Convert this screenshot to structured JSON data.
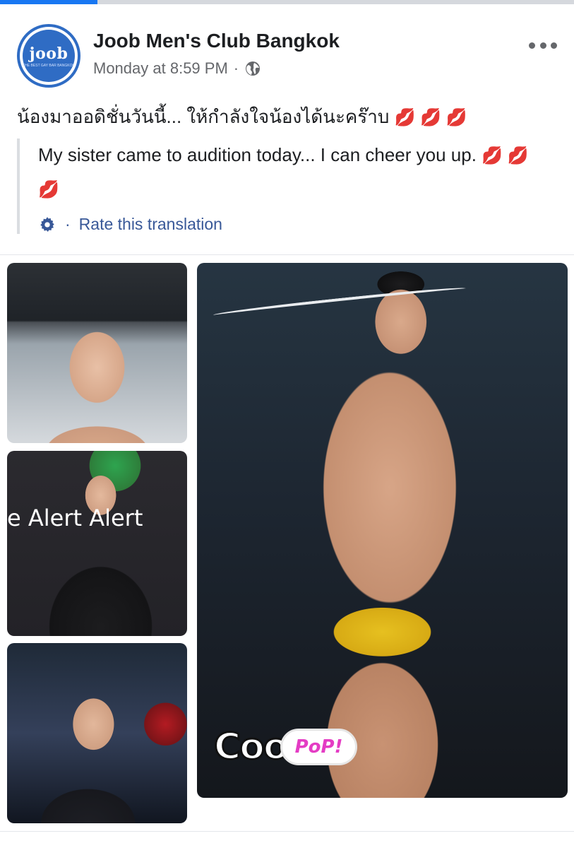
{
  "progress": {
    "value": 0.17,
    "color": "#1877f2"
  },
  "post": {
    "page_name": "Joob Men's Club Bangkok",
    "avatar": {
      "logo_text": "joob",
      "subtitle": "THE BEST GAY BAR BANGKOK"
    },
    "timestamp": "Monday at 8:59 PM",
    "separator": "·",
    "audience_icon": "globe-icon",
    "more_icon": "ellipsis-icon",
    "text": "น้องมาออดิชั่นวันนี้... ให้กำลังใจน้องได้นะคร๊าบ",
    "emoji": "💋 💋 💋"
  },
  "translation": {
    "text": "My sister came to audition today... I can cheer you up.",
    "emoji": "💋 💋 💋",
    "settings_icon": "gear-icon",
    "separator": "·",
    "rate_label": "Rate this translation"
  },
  "photos": {
    "photo_2_caption": "e Alert    Alert",
    "sticker_cool": "Coo",
    "sticker_pop": "PoP!"
  },
  "colors": {
    "link": "#385898",
    "meta": "#65676b",
    "avatar_blue": "#2f6cc4"
  }
}
